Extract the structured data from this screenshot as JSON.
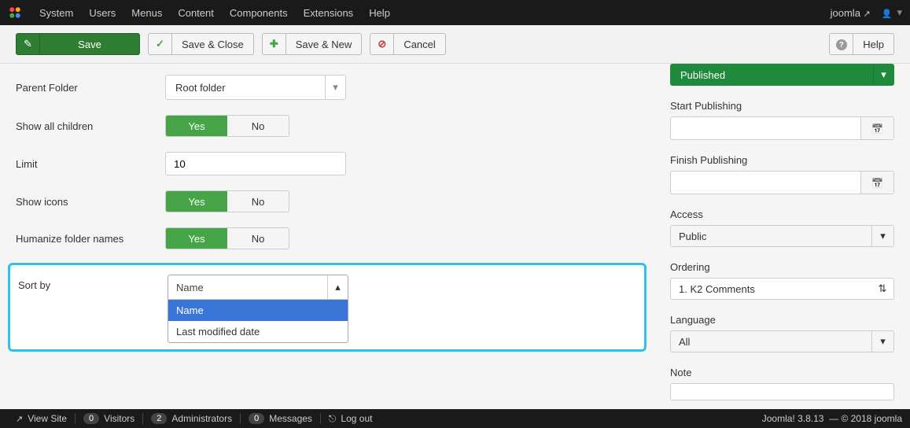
{
  "topbar": {
    "menus": [
      "System",
      "Users",
      "Menus",
      "Content",
      "Components",
      "Extensions",
      "Help"
    ],
    "site_name": "joomla"
  },
  "toolbar": {
    "save": "Save",
    "save_close": "Save & Close",
    "save_new": "Save & New",
    "cancel": "Cancel",
    "help": "Help"
  },
  "left": {
    "parent_folder": {
      "label": "Parent Folder",
      "value": "Root folder"
    },
    "show_all_children": {
      "label": "Show all children",
      "yes": "Yes",
      "no": "No",
      "value": "Yes"
    },
    "limit": {
      "label": "Limit",
      "value": "10"
    },
    "show_icons": {
      "label": "Show icons",
      "yes": "Yes",
      "no": "No",
      "value": "Yes"
    },
    "humanize": {
      "label": "Humanize folder names",
      "yes": "Yes",
      "no": "No",
      "value": "Yes"
    },
    "sort_by": {
      "label": "Sort by",
      "value": "Name",
      "options": [
        "Name",
        "Last modified date"
      ]
    }
  },
  "right": {
    "status": {
      "value": "Published"
    },
    "start_publishing": {
      "label": "Start Publishing",
      "value": ""
    },
    "finish_publishing": {
      "label": "Finish Publishing",
      "value": ""
    },
    "access": {
      "label": "Access",
      "value": "Public"
    },
    "ordering": {
      "label": "Ordering",
      "value": "1. K2 Comments"
    },
    "language": {
      "label": "Language",
      "value": "All"
    },
    "note": {
      "label": "Note",
      "value": ""
    }
  },
  "statusbar": {
    "view_site": "View Site",
    "visitors": {
      "count": "0",
      "label": "Visitors"
    },
    "admins": {
      "count": "2",
      "label": "Administrators"
    },
    "messages": {
      "count": "0",
      "label": "Messages"
    },
    "logout": "Log out",
    "version": "Joomla! 3.8.13",
    "copyright": "— © 2018 joomla"
  }
}
